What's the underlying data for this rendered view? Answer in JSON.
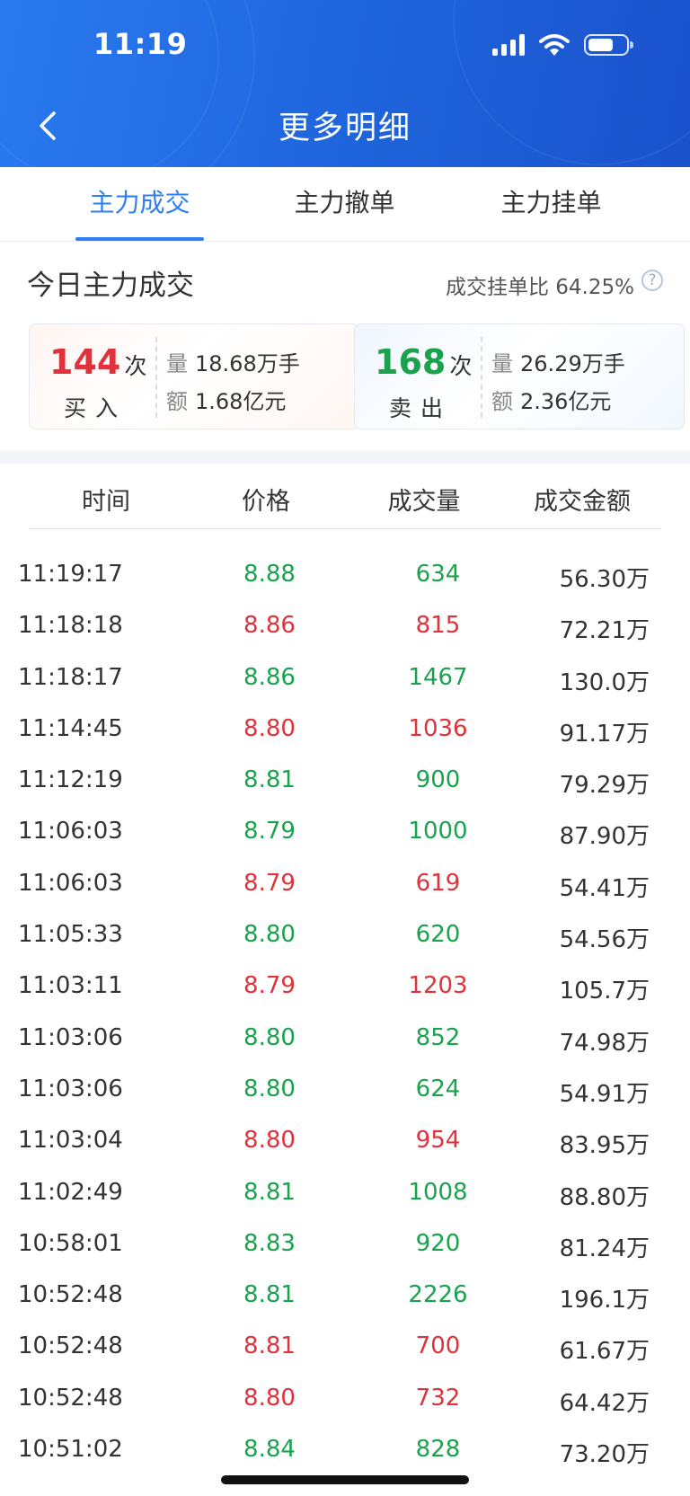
{
  "status_bar": {
    "time": "11:19"
  },
  "header": {
    "title": "更多明细"
  },
  "tabs": [
    {
      "label": "主力成交",
      "active": true
    },
    {
      "label": "主力撤单",
      "active": false
    },
    {
      "label": "主力挂单",
      "active": false
    }
  ],
  "summary": {
    "title": "今日主力成交",
    "ratio_label": "成交挂单比 64.25%",
    "help": "?",
    "buy": {
      "count": "144",
      "count_unit": "次",
      "label": "买入",
      "volume_key": "量",
      "volume": "18.68万手",
      "amount_key": "额",
      "amount": "1.68亿元"
    },
    "sell": {
      "count": "168",
      "count_unit": "次",
      "label": "卖出",
      "volume_key": "量",
      "volume": "26.29万手",
      "amount_key": "额",
      "amount": "2.36亿元"
    }
  },
  "table": {
    "headers": [
      "时间",
      "价格",
      "成交量",
      "成交金额"
    ],
    "rows": [
      {
        "time": "11:19:17",
        "price": "8.88",
        "volume": "634",
        "amount": "56.30万",
        "dir": "down"
      },
      {
        "time": "11:18:18",
        "price": "8.86",
        "volume": "815",
        "amount": "72.21万",
        "dir": "up"
      },
      {
        "time": "11:18:17",
        "price": "8.86",
        "volume": "1467",
        "amount": "130.0万",
        "dir": "down"
      },
      {
        "time": "11:14:45",
        "price": "8.80",
        "volume": "1036",
        "amount": "91.17万",
        "dir": "up"
      },
      {
        "time": "11:12:19",
        "price": "8.81",
        "volume": "900",
        "amount": "79.29万",
        "dir": "down"
      },
      {
        "time": "11:06:03",
        "price": "8.79",
        "volume": "1000",
        "amount": "87.90万",
        "dir": "down"
      },
      {
        "time": "11:06:03",
        "price": "8.79",
        "volume": "619",
        "amount": "54.41万",
        "dir": "up"
      },
      {
        "time": "11:05:33",
        "price": "8.80",
        "volume": "620",
        "amount": "54.56万",
        "dir": "down"
      },
      {
        "time": "11:03:11",
        "price": "8.79",
        "volume": "1203",
        "amount": "105.7万",
        "dir": "up"
      },
      {
        "time": "11:03:06",
        "price": "8.80",
        "volume": "852",
        "amount": "74.98万",
        "dir": "down"
      },
      {
        "time": "11:03:06",
        "price": "8.80",
        "volume": "624",
        "amount": "54.91万",
        "dir": "down"
      },
      {
        "time": "11:03:04",
        "price": "8.80",
        "volume": "954",
        "amount": "83.95万",
        "dir": "up"
      },
      {
        "time": "11:02:49",
        "price": "8.81",
        "volume": "1008",
        "amount": "88.80万",
        "dir": "down"
      },
      {
        "time": "10:58:01",
        "price": "8.83",
        "volume": "920",
        "amount": "81.24万",
        "dir": "down"
      },
      {
        "time": "10:52:48",
        "price": "8.81",
        "volume": "2226",
        "amount": "196.1万",
        "dir": "down"
      },
      {
        "time": "10:52:48",
        "price": "8.81",
        "volume": "700",
        "amount": "61.67万",
        "dir": "up"
      },
      {
        "time": "10:52:48",
        "price": "8.80",
        "volume": "732",
        "amount": "64.42万",
        "dir": "up"
      },
      {
        "time": "10:51:02",
        "price": "8.84",
        "volume": "828",
        "amount": "73.20万",
        "dir": "down"
      }
    ]
  },
  "colors": {
    "header_blue": "#1e63db",
    "accent": "#2f7ff0",
    "up_red": "#e0323c",
    "down_green": "#1aa24c"
  }
}
